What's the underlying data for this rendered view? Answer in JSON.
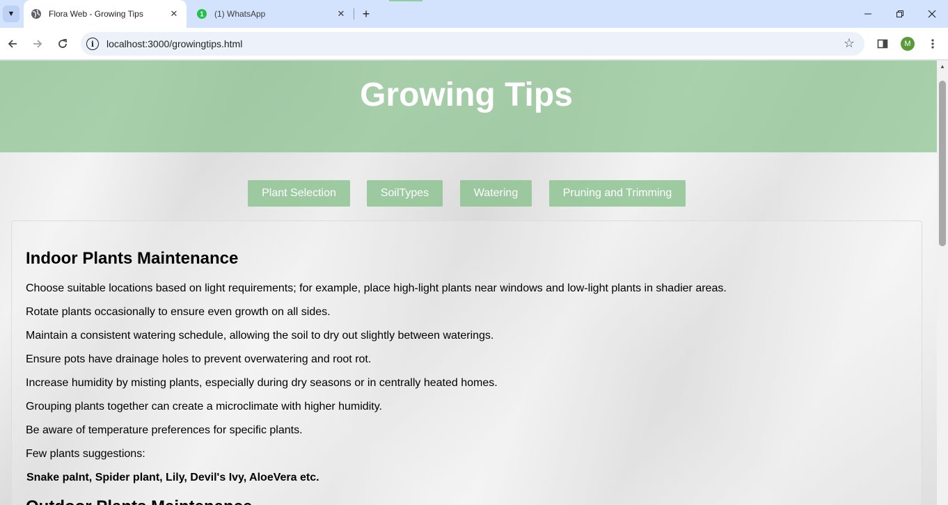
{
  "browser": {
    "tabs": [
      {
        "title": "Flora Web - Growing Tips",
        "active": true,
        "icon": "globe-icon"
      },
      {
        "title": "(1) WhatsApp",
        "active": false,
        "icon": "whatsapp-icon",
        "badge": "1"
      }
    ],
    "address": "localhost:3000/growingtips.html",
    "profile_initial": "M",
    "colors": {
      "tabstrip": "#d3e3fd",
      "omnibox": "#edf2fa",
      "avatar": "#5a9a3a"
    }
  },
  "page": {
    "title": "Growing Tips",
    "nav": [
      "Plant Selection",
      "SoilTypes",
      "Watering",
      "Pruning and Trimming"
    ],
    "colors": {
      "banner": "#a8cfa7",
      "nav_button": "#93c594",
      "text": "#000000"
    },
    "section": {
      "heading": "Indoor Plants Maintenance",
      "paragraphs": [
        "Choose suitable locations based on light requirements; for example, place high-light plants near windows and low-light plants in shadier areas.",
        "Rotate plants occasionally to ensure even growth on all sides.",
        "Maintain a consistent watering schedule, allowing the soil to dry out slightly between waterings.",
        "Ensure pots have drainage holes to prevent overwatering and root rot.",
        "Increase humidity by misting plants, especially during dry seasons or in centrally heated homes.",
        "Grouping plants together can create a microclimate with higher humidity.",
        "Be aware of temperature preferences for specific plants.",
        "Few plants suggestions:"
      ],
      "suggestions": "Snake palnt, Spider plant, Lily, Devil's Ivy, AloeVera etc."
    },
    "next_heading": "Outdoor Plants Maintenance"
  }
}
